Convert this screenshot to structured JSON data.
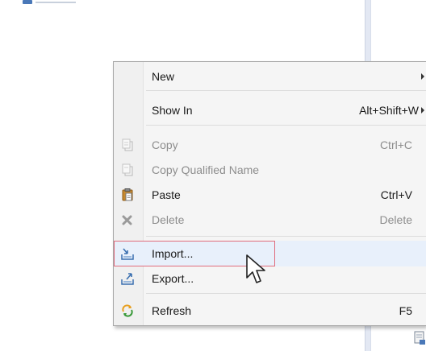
{
  "menu": {
    "items": [
      {
        "label": "New",
        "shortcut": "",
        "submenu": true,
        "enabled": true,
        "icon": ""
      },
      {
        "label": "Show In",
        "shortcut": "Alt+Shift+W",
        "submenu": true,
        "enabled": true,
        "icon": ""
      },
      {
        "label": "Copy",
        "shortcut": "Ctrl+C",
        "submenu": false,
        "enabled": false,
        "icon": "copy-icon"
      },
      {
        "label": "Copy Qualified Name",
        "shortcut": "",
        "submenu": false,
        "enabled": false,
        "icon": "copy-qualified-name-icon"
      },
      {
        "label": "Paste",
        "shortcut": "Ctrl+V",
        "submenu": false,
        "enabled": true,
        "icon": "paste-icon"
      },
      {
        "label": "Delete",
        "shortcut": "Delete",
        "submenu": false,
        "enabled": false,
        "icon": "delete-icon"
      },
      {
        "label": "Import...",
        "shortcut": "",
        "submenu": false,
        "enabled": true,
        "icon": "import-icon",
        "hovered": true
      },
      {
        "label": "Export...",
        "shortcut": "",
        "submenu": false,
        "enabled": true,
        "icon": "export-icon"
      },
      {
        "label": "Refresh",
        "shortcut": "F5",
        "submenu": false,
        "enabled": true,
        "icon": "refresh-icon"
      }
    ]
  },
  "colors": {
    "highlight_border": "#e06c7c",
    "disabled_text": "#8d8d8d",
    "import_icon": "#3a6fb0",
    "refresh_icon": "#e8a020"
  }
}
